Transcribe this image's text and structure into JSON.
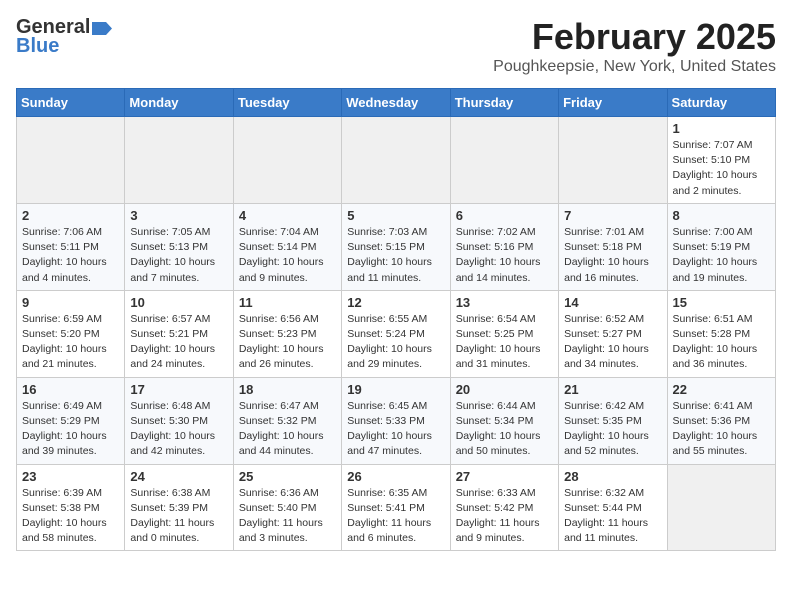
{
  "logo": {
    "general": "General",
    "blue": "Blue"
  },
  "title": "February 2025",
  "location": "Poughkeepsie, New York, United States",
  "weekdays": [
    "Sunday",
    "Monday",
    "Tuesday",
    "Wednesday",
    "Thursday",
    "Friday",
    "Saturday"
  ],
  "weeks": [
    [
      {
        "day": "",
        "info": ""
      },
      {
        "day": "",
        "info": ""
      },
      {
        "day": "",
        "info": ""
      },
      {
        "day": "",
        "info": ""
      },
      {
        "day": "",
        "info": ""
      },
      {
        "day": "",
        "info": ""
      },
      {
        "day": "1",
        "info": "Sunrise: 7:07 AM\nSunset: 5:10 PM\nDaylight: 10 hours\nand 2 minutes."
      }
    ],
    [
      {
        "day": "2",
        "info": "Sunrise: 7:06 AM\nSunset: 5:11 PM\nDaylight: 10 hours\nand 4 minutes."
      },
      {
        "day": "3",
        "info": "Sunrise: 7:05 AM\nSunset: 5:13 PM\nDaylight: 10 hours\nand 7 minutes."
      },
      {
        "day": "4",
        "info": "Sunrise: 7:04 AM\nSunset: 5:14 PM\nDaylight: 10 hours\nand 9 minutes."
      },
      {
        "day": "5",
        "info": "Sunrise: 7:03 AM\nSunset: 5:15 PM\nDaylight: 10 hours\nand 11 minutes."
      },
      {
        "day": "6",
        "info": "Sunrise: 7:02 AM\nSunset: 5:16 PM\nDaylight: 10 hours\nand 14 minutes."
      },
      {
        "day": "7",
        "info": "Sunrise: 7:01 AM\nSunset: 5:18 PM\nDaylight: 10 hours\nand 16 minutes."
      },
      {
        "day": "8",
        "info": "Sunrise: 7:00 AM\nSunset: 5:19 PM\nDaylight: 10 hours\nand 19 minutes."
      }
    ],
    [
      {
        "day": "9",
        "info": "Sunrise: 6:59 AM\nSunset: 5:20 PM\nDaylight: 10 hours\nand 21 minutes."
      },
      {
        "day": "10",
        "info": "Sunrise: 6:57 AM\nSunset: 5:21 PM\nDaylight: 10 hours\nand 24 minutes."
      },
      {
        "day": "11",
        "info": "Sunrise: 6:56 AM\nSunset: 5:23 PM\nDaylight: 10 hours\nand 26 minutes."
      },
      {
        "day": "12",
        "info": "Sunrise: 6:55 AM\nSunset: 5:24 PM\nDaylight: 10 hours\nand 29 minutes."
      },
      {
        "day": "13",
        "info": "Sunrise: 6:54 AM\nSunset: 5:25 PM\nDaylight: 10 hours\nand 31 minutes."
      },
      {
        "day": "14",
        "info": "Sunrise: 6:52 AM\nSunset: 5:27 PM\nDaylight: 10 hours\nand 34 minutes."
      },
      {
        "day": "15",
        "info": "Sunrise: 6:51 AM\nSunset: 5:28 PM\nDaylight: 10 hours\nand 36 minutes."
      }
    ],
    [
      {
        "day": "16",
        "info": "Sunrise: 6:49 AM\nSunset: 5:29 PM\nDaylight: 10 hours\nand 39 minutes."
      },
      {
        "day": "17",
        "info": "Sunrise: 6:48 AM\nSunset: 5:30 PM\nDaylight: 10 hours\nand 42 minutes."
      },
      {
        "day": "18",
        "info": "Sunrise: 6:47 AM\nSunset: 5:32 PM\nDaylight: 10 hours\nand 44 minutes."
      },
      {
        "day": "19",
        "info": "Sunrise: 6:45 AM\nSunset: 5:33 PM\nDaylight: 10 hours\nand 47 minutes."
      },
      {
        "day": "20",
        "info": "Sunrise: 6:44 AM\nSunset: 5:34 PM\nDaylight: 10 hours\nand 50 minutes."
      },
      {
        "day": "21",
        "info": "Sunrise: 6:42 AM\nSunset: 5:35 PM\nDaylight: 10 hours\nand 52 minutes."
      },
      {
        "day": "22",
        "info": "Sunrise: 6:41 AM\nSunset: 5:36 PM\nDaylight: 10 hours\nand 55 minutes."
      }
    ],
    [
      {
        "day": "23",
        "info": "Sunrise: 6:39 AM\nSunset: 5:38 PM\nDaylight: 10 hours\nand 58 minutes."
      },
      {
        "day": "24",
        "info": "Sunrise: 6:38 AM\nSunset: 5:39 PM\nDaylight: 11 hours\nand 0 minutes."
      },
      {
        "day": "25",
        "info": "Sunrise: 6:36 AM\nSunset: 5:40 PM\nDaylight: 11 hours\nand 3 minutes."
      },
      {
        "day": "26",
        "info": "Sunrise: 6:35 AM\nSunset: 5:41 PM\nDaylight: 11 hours\nand 6 minutes."
      },
      {
        "day": "27",
        "info": "Sunrise: 6:33 AM\nSunset: 5:42 PM\nDaylight: 11 hours\nand 9 minutes."
      },
      {
        "day": "28",
        "info": "Sunrise: 6:32 AM\nSunset: 5:44 PM\nDaylight: 11 hours\nand 11 minutes."
      },
      {
        "day": "",
        "info": ""
      }
    ]
  ]
}
